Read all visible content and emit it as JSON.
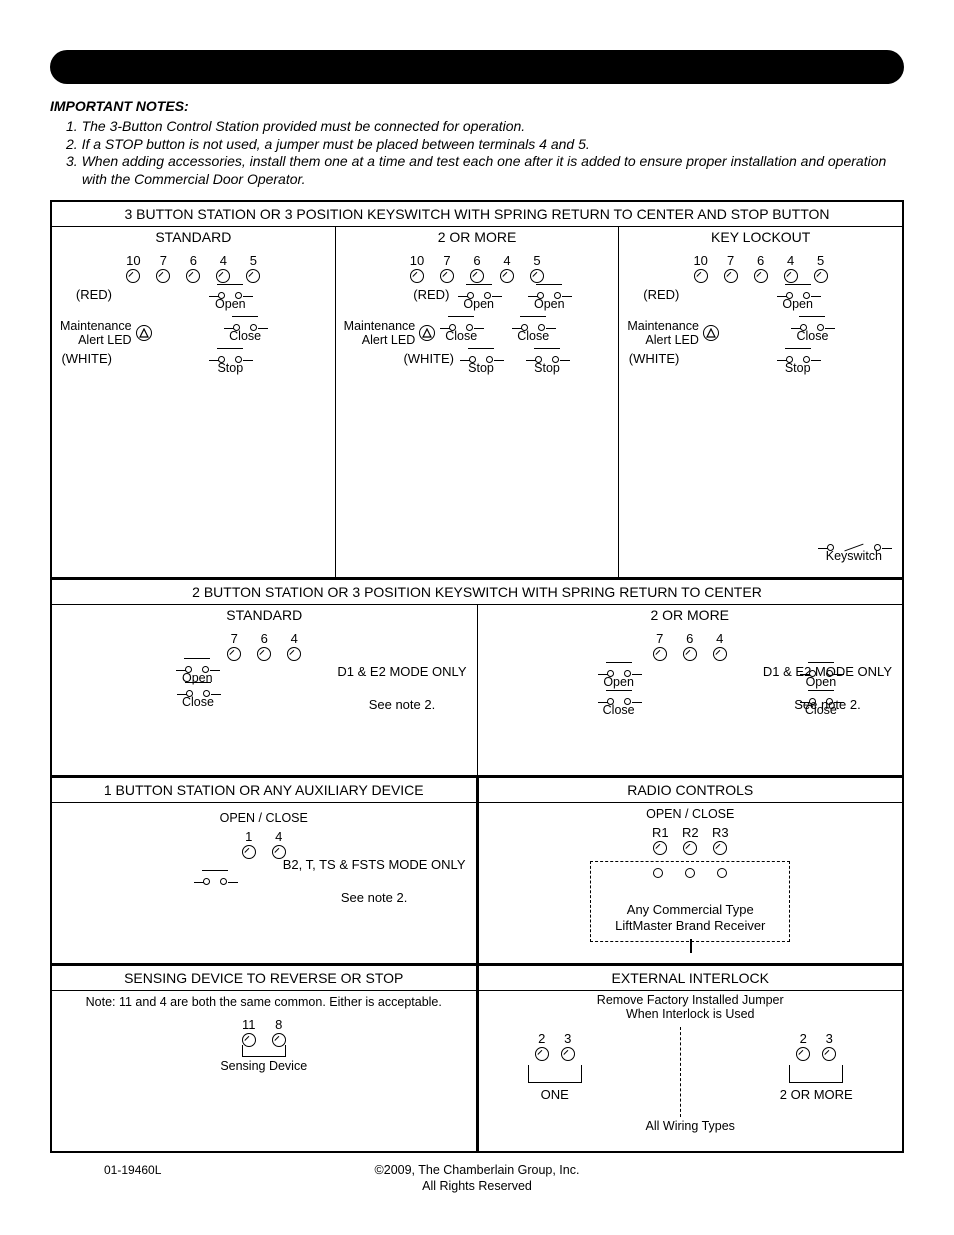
{
  "notes": {
    "heading": "IMPORTANT NOTES:",
    "items": [
      "1. The 3-Button Control Station provided must be connected for operation.",
      "2. If a STOP button is not used, a jumper must be placed between terminals 4 and 5.",
      "3. When adding accessories, install them one at a time and test each one after it is added to ensure proper installation and operation with the Commercial Door Operator."
    ]
  },
  "section_3btn": {
    "title": "3 BUTTON STATION OR 3 POSITION KEYSWITCH WITH SPRING RETURN TO CENTER AND STOP BUTTON",
    "standard": {
      "title": "STANDARD",
      "terminals": [
        "10",
        "7",
        "6",
        "4",
        "5"
      ],
      "red": "(RED)",
      "white": "(WHITE)",
      "maint": "Maintenance",
      "alert": "Alert LED",
      "open": "Open",
      "close": "Close",
      "stop": "Stop"
    },
    "two_or_more": {
      "title": "2 OR MORE",
      "terminals": [
        "10",
        "7",
        "6",
        "4",
        "5"
      ],
      "red": "(RED)",
      "white": "(WHITE)",
      "maint": "Maintenance",
      "alert": "Alert LED",
      "open": "Open",
      "close": "Close",
      "stop": "Stop"
    },
    "key_lockout": {
      "title": "KEY LOCKOUT",
      "terminals": [
        "10",
        "7",
        "6",
        "4",
        "5"
      ],
      "red": "(RED)",
      "white": "(WHITE)",
      "maint": "Maintenance",
      "alert": "Alert LED",
      "open": "Open",
      "close": "Close",
      "stop": "Stop",
      "keyswitch": "Keyswitch"
    }
  },
  "section_2btn": {
    "title": "2 BUTTON STATION OR 3 POSITION KEYSWITCH WITH SPRING RETURN TO CENTER",
    "standard": {
      "title": "STANDARD",
      "terminals": [
        "7",
        "6",
        "4"
      ],
      "open": "Open",
      "close": "Close",
      "mode": "D1 & E2 MODE ONLY",
      "note": "See note 2."
    },
    "two_or_more": {
      "title": "2 OR MORE",
      "terminals": [
        "7",
        "6",
        "4"
      ],
      "open": "Open",
      "close": "Close",
      "mode": "D1 & E2 MODE ONLY",
      "note": "See note 2."
    }
  },
  "section_1btn_radio": {
    "left": {
      "title": "1 BUTTON STATION OR ANY AUXILIARY DEVICE",
      "oc": "OPEN / CLOSE",
      "terminals": [
        "1",
        "4"
      ],
      "mode": "B2, T, TS & FSTS MODE ONLY",
      "note": "See note 2."
    },
    "right": {
      "title": "RADIO CONTROLS",
      "oc": "OPEN / CLOSE",
      "terminals": [
        "R1",
        "R2",
        "R3"
      ],
      "box1": "Any Commercial Type",
      "box2": "LiftMaster Brand Receiver"
    }
  },
  "section_sense_interlock": {
    "left": {
      "title": "SENSING DEVICE TO REVERSE OR STOP",
      "note": "Note: 11 and 4 are both the same common. Either is acceptable.",
      "terminals": [
        "11",
        "8"
      ],
      "device": "Sensing Device"
    },
    "right": {
      "title": "EXTERNAL INTERLOCK",
      "remove1": "Remove Factory Installed Jumper",
      "remove2": "When Interlock is Used",
      "one": {
        "terminals": [
          "2",
          "3"
        ],
        "label": "ONE"
      },
      "more": {
        "terminals": [
          "2",
          "3"
        ],
        "label": "2 OR MORE"
      },
      "all": "All Wiring Types"
    }
  },
  "footer": {
    "copyright": "©2009, The Chamberlain Group, Inc.",
    "rights": "All Rights Reserved",
    "docnum": "01-19460L"
  }
}
